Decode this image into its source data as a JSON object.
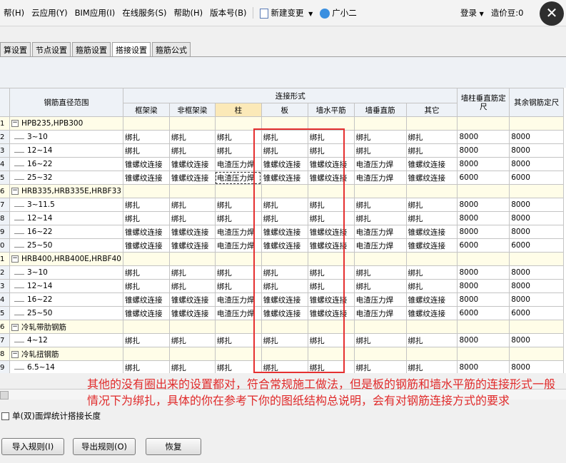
{
  "menu": {
    "items": [
      "帮(H)",
      "云应用(Y)",
      "BIM应用(I)",
      "在线服务(S)",
      "帮助(H)",
      "版本号(B)"
    ],
    "new_change": "新建变更",
    "user_name": "广小二",
    "login": "登录",
    "price_bean": "造价豆:0"
  },
  "close_glyph": "✕",
  "tabs": [
    "算设置",
    "节点设置",
    "箍筋设置",
    "搭接设置",
    "箍筋公式"
  ],
  "active_tab": 3,
  "table": {
    "header": {
      "range": "钢筋直径范围",
      "connection_form": "连接形式",
      "cols": [
        "框架梁",
        "非框架梁",
        "柱",
        "板",
        "墙水平筋",
        "墙垂直筋",
        "其它"
      ],
      "wall_vertical_length": "墙柱垂直筋定尺",
      "other_length": "其余钢筋定尺"
    },
    "rows": [
      {
        "n": "1",
        "group": true,
        "name": "HPB235,HPB300",
        "cells": [
          "",
          "",
          "",
          "",
          "",
          "",
          ""
        ],
        "l1": "",
        "l2": ""
      },
      {
        "n": "2",
        "name": "3~10",
        "cells": [
          "绑扎",
          "绑扎",
          "绑扎",
          "绑扎",
          "绑扎",
          "绑扎",
          "绑扎"
        ],
        "l1": "8000",
        "l2": "8000"
      },
      {
        "n": "3",
        "name": "12~14",
        "cells": [
          "绑扎",
          "绑扎",
          "绑扎",
          "绑扎",
          "绑扎",
          "绑扎",
          "绑扎"
        ],
        "l1": "8000",
        "l2": "8000"
      },
      {
        "n": "4",
        "name": "16~22",
        "cells": [
          "锥螺纹连接",
          "锥螺纹连接",
          "电渣压力焊",
          "锥螺纹连接",
          "锥螺纹连接",
          "电渣压力焊",
          "锥螺纹连接"
        ],
        "l1": "8000",
        "l2": "8000"
      },
      {
        "n": "5",
        "name": "25~32",
        "cells": [
          "锥螺纹连接",
          "锥螺纹连接",
          "电渣压力焊",
          "锥螺纹连接",
          "锥螺纹连接",
          "电渣压力焊",
          "锥螺纹连接"
        ],
        "l1": "6000",
        "l2": "6000"
      },
      {
        "n": "6",
        "group": true,
        "name": "HRB335,HRB335E,HRBF33",
        "cells": [
          "",
          "",
          "",
          "",
          "",
          "",
          ""
        ],
        "l1": "",
        "l2": ""
      },
      {
        "n": "7",
        "name": "3~11.5",
        "cells": [
          "绑扎",
          "绑扎",
          "绑扎",
          "绑扎",
          "绑扎",
          "绑扎",
          "绑扎"
        ],
        "l1": "8000",
        "l2": "8000"
      },
      {
        "n": "8",
        "name": "12~14",
        "cells": [
          "绑扎",
          "绑扎",
          "绑扎",
          "绑扎",
          "绑扎",
          "绑扎",
          "绑扎"
        ],
        "l1": "8000",
        "l2": "8000"
      },
      {
        "n": "9",
        "name": "16~22",
        "cells": [
          "锥螺纹连接",
          "锥螺纹连接",
          "电渣压力焊",
          "锥螺纹连接",
          "锥螺纹连接",
          "电渣压力焊",
          "锥螺纹连接"
        ],
        "l1": "8000",
        "l2": "8000"
      },
      {
        "n": "0",
        "name": "25~50",
        "cells": [
          "锥螺纹连接",
          "锥螺纹连接",
          "电渣压力焊",
          "锥螺纹连接",
          "锥螺纹连接",
          "电渣压力焊",
          "锥螺纹连接"
        ],
        "l1": "6000",
        "l2": "6000"
      },
      {
        "n": "1",
        "group": true,
        "name": "HRB400,HRB400E,HRBF40",
        "cells": [
          "",
          "",
          "",
          "",
          "",
          "",
          ""
        ],
        "l1": "",
        "l2": ""
      },
      {
        "n": "2",
        "name": "3~10",
        "cells": [
          "绑扎",
          "绑扎",
          "绑扎",
          "绑扎",
          "绑扎",
          "绑扎",
          "绑扎"
        ],
        "l1": "8000",
        "l2": "8000"
      },
      {
        "n": "3",
        "name": "12~14",
        "cells": [
          "绑扎",
          "绑扎",
          "绑扎",
          "绑扎",
          "绑扎",
          "绑扎",
          "绑扎"
        ],
        "l1": "8000",
        "l2": "8000"
      },
      {
        "n": "4",
        "name": "16~22",
        "cells": [
          "锥螺纹连接",
          "锥螺纹连接",
          "电渣压力焊",
          "锥螺纹连接",
          "锥螺纹连接",
          "电渣压力焊",
          "锥螺纹连接"
        ],
        "l1": "8000",
        "l2": "8000"
      },
      {
        "n": "5",
        "name": "25~50",
        "cells": [
          "锥螺纹连接",
          "锥螺纹连接",
          "电渣压力焊",
          "锥螺纹连接",
          "锥螺纹连接",
          "电渣压力焊",
          "锥螺纹连接"
        ],
        "l1": "6000",
        "l2": "6000"
      },
      {
        "n": "6",
        "group": true,
        "name": "冷轧带肋钢筋",
        "cells": [
          "",
          "",
          "",
          "",
          "",
          "",
          ""
        ],
        "l1": "",
        "l2": ""
      },
      {
        "n": "7",
        "name": "4~12",
        "cells": [
          "绑扎",
          "绑扎",
          "绑扎",
          "绑扎",
          "绑扎",
          "绑扎",
          "绑扎"
        ],
        "l1": "8000",
        "l2": "8000"
      },
      {
        "n": "8",
        "group": true,
        "name": "冷轧扭钢筋",
        "cells": [
          "",
          "",
          "",
          "",
          "",
          "",
          ""
        ],
        "l1": "",
        "l2": ""
      },
      {
        "n": "9",
        "name": "6.5~14",
        "cells": [
          "绑扎",
          "绑扎",
          "绑扎",
          "绑扎",
          "绑扎",
          "绑扎",
          "绑扎"
        ],
        "l1": "8000",
        "l2": "8000"
      }
    ]
  },
  "annotation": "其他的没有圈出来的设置都对，符合常规施工做法，但是板的钢筋和墙水平筋的连接形式一般情况下为绑扎，具体的你在参考下你的图纸结构总说明，会有对钢筋连接方式的要求",
  "checkbox_label": "单(双)面焊统计搭接长度",
  "buttons": {
    "import": "导入规则(I)",
    "export": "导出规则(O)",
    "restore": "恢复"
  },
  "colors": {
    "annotation": "#e02a2a",
    "highlight_header": "#fbe9b8",
    "group_row": "#fffde8"
  }
}
